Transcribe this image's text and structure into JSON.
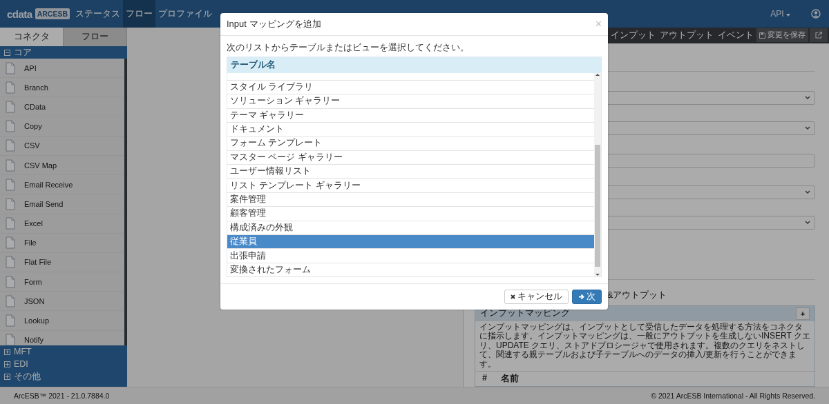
{
  "header": {
    "logo": "cdata",
    "badge": "ARCESB",
    "nav": [
      {
        "label": "ステータス",
        "selected": false
      },
      {
        "label": "フロー",
        "selected": true
      },
      {
        "label": "プロファイル",
        "selected": false
      }
    ],
    "user_menu": "API"
  },
  "sidebar": {
    "tabs": [
      {
        "label": "コネクタ",
        "selected": true
      },
      {
        "label": "フロー",
        "selected": false
      }
    ],
    "groups": [
      {
        "label": "コア",
        "expanded": true,
        "items": [
          "API",
          "Branch",
          "CData",
          "Copy",
          "CSV",
          "CSV Map",
          "Email Receive",
          "Email Send",
          "Excel",
          "File",
          "Flat File",
          "Form",
          "JSON",
          "Lookup",
          "Notify"
        ]
      },
      {
        "label": "MFT",
        "expanded": false
      },
      {
        "label": "EDI",
        "expanded": false
      },
      {
        "label": "その他",
        "expanded": false
      }
    ]
  },
  "panel": {
    "tabs": [
      {
        "label": "インプット",
        "selected": false
      },
      {
        "label": "アウトプット",
        "selected": false
      },
      {
        "label": "イベント",
        "selected": false
      }
    ],
    "save_button": "変更を保存",
    "fields": [
      {
        "kind": "select"
      },
      {
        "kind": "select"
      },
      {
        "kind": "text"
      },
      {
        "kind": "select"
      },
      {
        "kind": "select"
      }
    ],
    "section_label": "&アウトプット",
    "mapping": {
      "title": "インプットマッピング",
      "add": "+",
      "description": "インプットマッピングは、インプットとして受信したデータを処理する方法をコネクタに指示します。インプットマッピングは、一般にアウトプットを生成しないINSERT クエリ、UPDATE クエリ、ストアドプロシージャで使用されます。複数のクエリをネストして、関連する親テーブルおよび子テーブルへのデータの挿入/更新を行うことができます。",
      "columns": [
        "#",
        "名前"
      ]
    }
  },
  "modal": {
    "title": "Input マッピングを追加",
    "close": "×",
    "instruction": "次のリストからテーブルまたはビューを選択してください。",
    "column": "テーブル名",
    "rows": [
      {
        "label": "スタイル ライブラリ",
        "selected": false
      },
      {
        "label": "ソリューション ギャラリー",
        "selected": false
      },
      {
        "label": "テーマ ギャラリー",
        "selected": false
      },
      {
        "label": "ドキュメント",
        "selected": false
      },
      {
        "label": "フォーム テンプレート",
        "selected": false
      },
      {
        "label": "マスター ページ ギャラリー",
        "selected": false
      },
      {
        "label": "ユーザー情報リスト",
        "selected": false
      },
      {
        "label": "リスト テンプレート ギャラリー",
        "selected": false
      },
      {
        "label": "案件管理",
        "selected": false
      },
      {
        "label": "顧客管理",
        "selected": false
      },
      {
        "label": "構成済みの外観",
        "selected": false
      },
      {
        "label": "従業員",
        "selected": true
      },
      {
        "label": "出張申請",
        "selected": false
      },
      {
        "label": "変換されたフォーム",
        "selected": false
      }
    ],
    "cancel": "キャンセル",
    "next": "次"
  },
  "footer": {
    "version": "ArcESB™ 2021 - 21.0.7884.0",
    "copyright": "© 2021 ArcESB International - All Rights Reserved."
  }
}
